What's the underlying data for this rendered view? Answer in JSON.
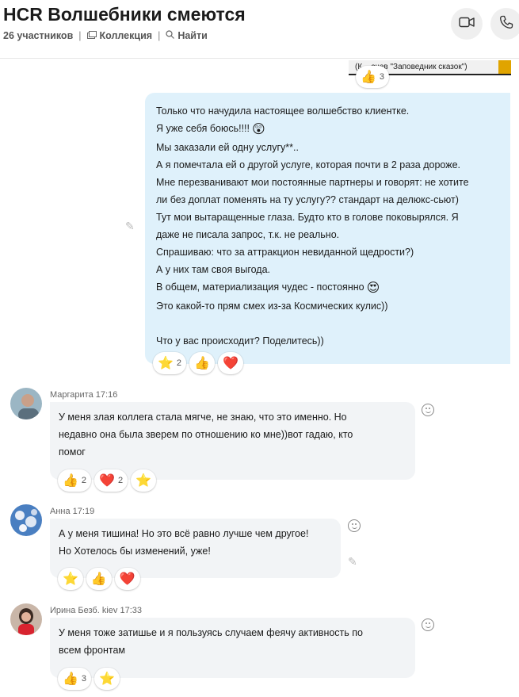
{
  "header": {
    "title": "HCR Волшебники смеются",
    "participants": "26 участников",
    "collection": "Коллекция",
    "find": "Найти"
  },
  "preview": {
    "caption": "(К... ачев \"Заповедник сказок\")",
    "thumbs_count": "3"
  },
  "outgoing": {
    "lines": [
      "Только что начудила настоящее волшебство клиентке.",
      "Я уже себя боюсь!!!!",
      "Мы заказали ей одну услугу**..",
      "А я помечтала ей о другой услуге, которая почти в 2 раза дороже.",
      "Мне перезванивают мои постоянные партнеры и говорят: не хотите",
      "ли без доплат поменять на ту услугу?? стандарт на делюкс-сьют)",
      "Тут мои вытаращенные глаза. Будто кто в голове поковырялся. Я",
      "даже не писала запрос, т.к. не реально.",
      "Спрашиваю: что за аттракцион невиданной щедрости?)",
      "А у них там своя выгода.",
      "В общем, материализация чудес - постоянно",
      "Это какой-то прям смех из-за Космических кулис))",
      "",
      "Что у вас происходит? Поделитесь))"
    ],
    "reactions": {
      "star_count": "2"
    }
  },
  "messages": [
    {
      "author": "Маргарита",
      "time": "17:16",
      "lines": [
        "У меня злая коллега стала мягче, не знаю, что это именно. Но",
        "недавно она была зверем по отношению ко мне))вот гадаю, кто",
        "помог"
      ],
      "thumbs_count": "2",
      "heart_count": "2"
    },
    {
      "author": "Анна",
      "time": "17:19",
      "lines": [
        "А у меня тишина! Но это всё равно лучше чем другое!",
        "Но Хотелось бы изменений, уже!"
      ]
    },
    {
      "author": "Ирина Безб. kiev",
      "time": "17:33",
      "lines": [
        "У меня тоже затишье и я пользуясь случаем феячу активность по",
        "всем фронтам"
      ],
      "thumbs_count": "3"
    }
  ],
  "colors": {
    "outgoing_bubble": "#dff1fb",
    "incoming_bubble": "#f2f4f6",
    "heart": "#e8192c",
    "star": "#f6c12a",
    "thumb": "#f2b33d"
  },
  "icons": [
    "video-call-icon",
    "phone-call-icon",
    "collection-icon",
    "search-icon",
    "edit-pencil-icon",
    "add-reaction-icon"
  ]
}
